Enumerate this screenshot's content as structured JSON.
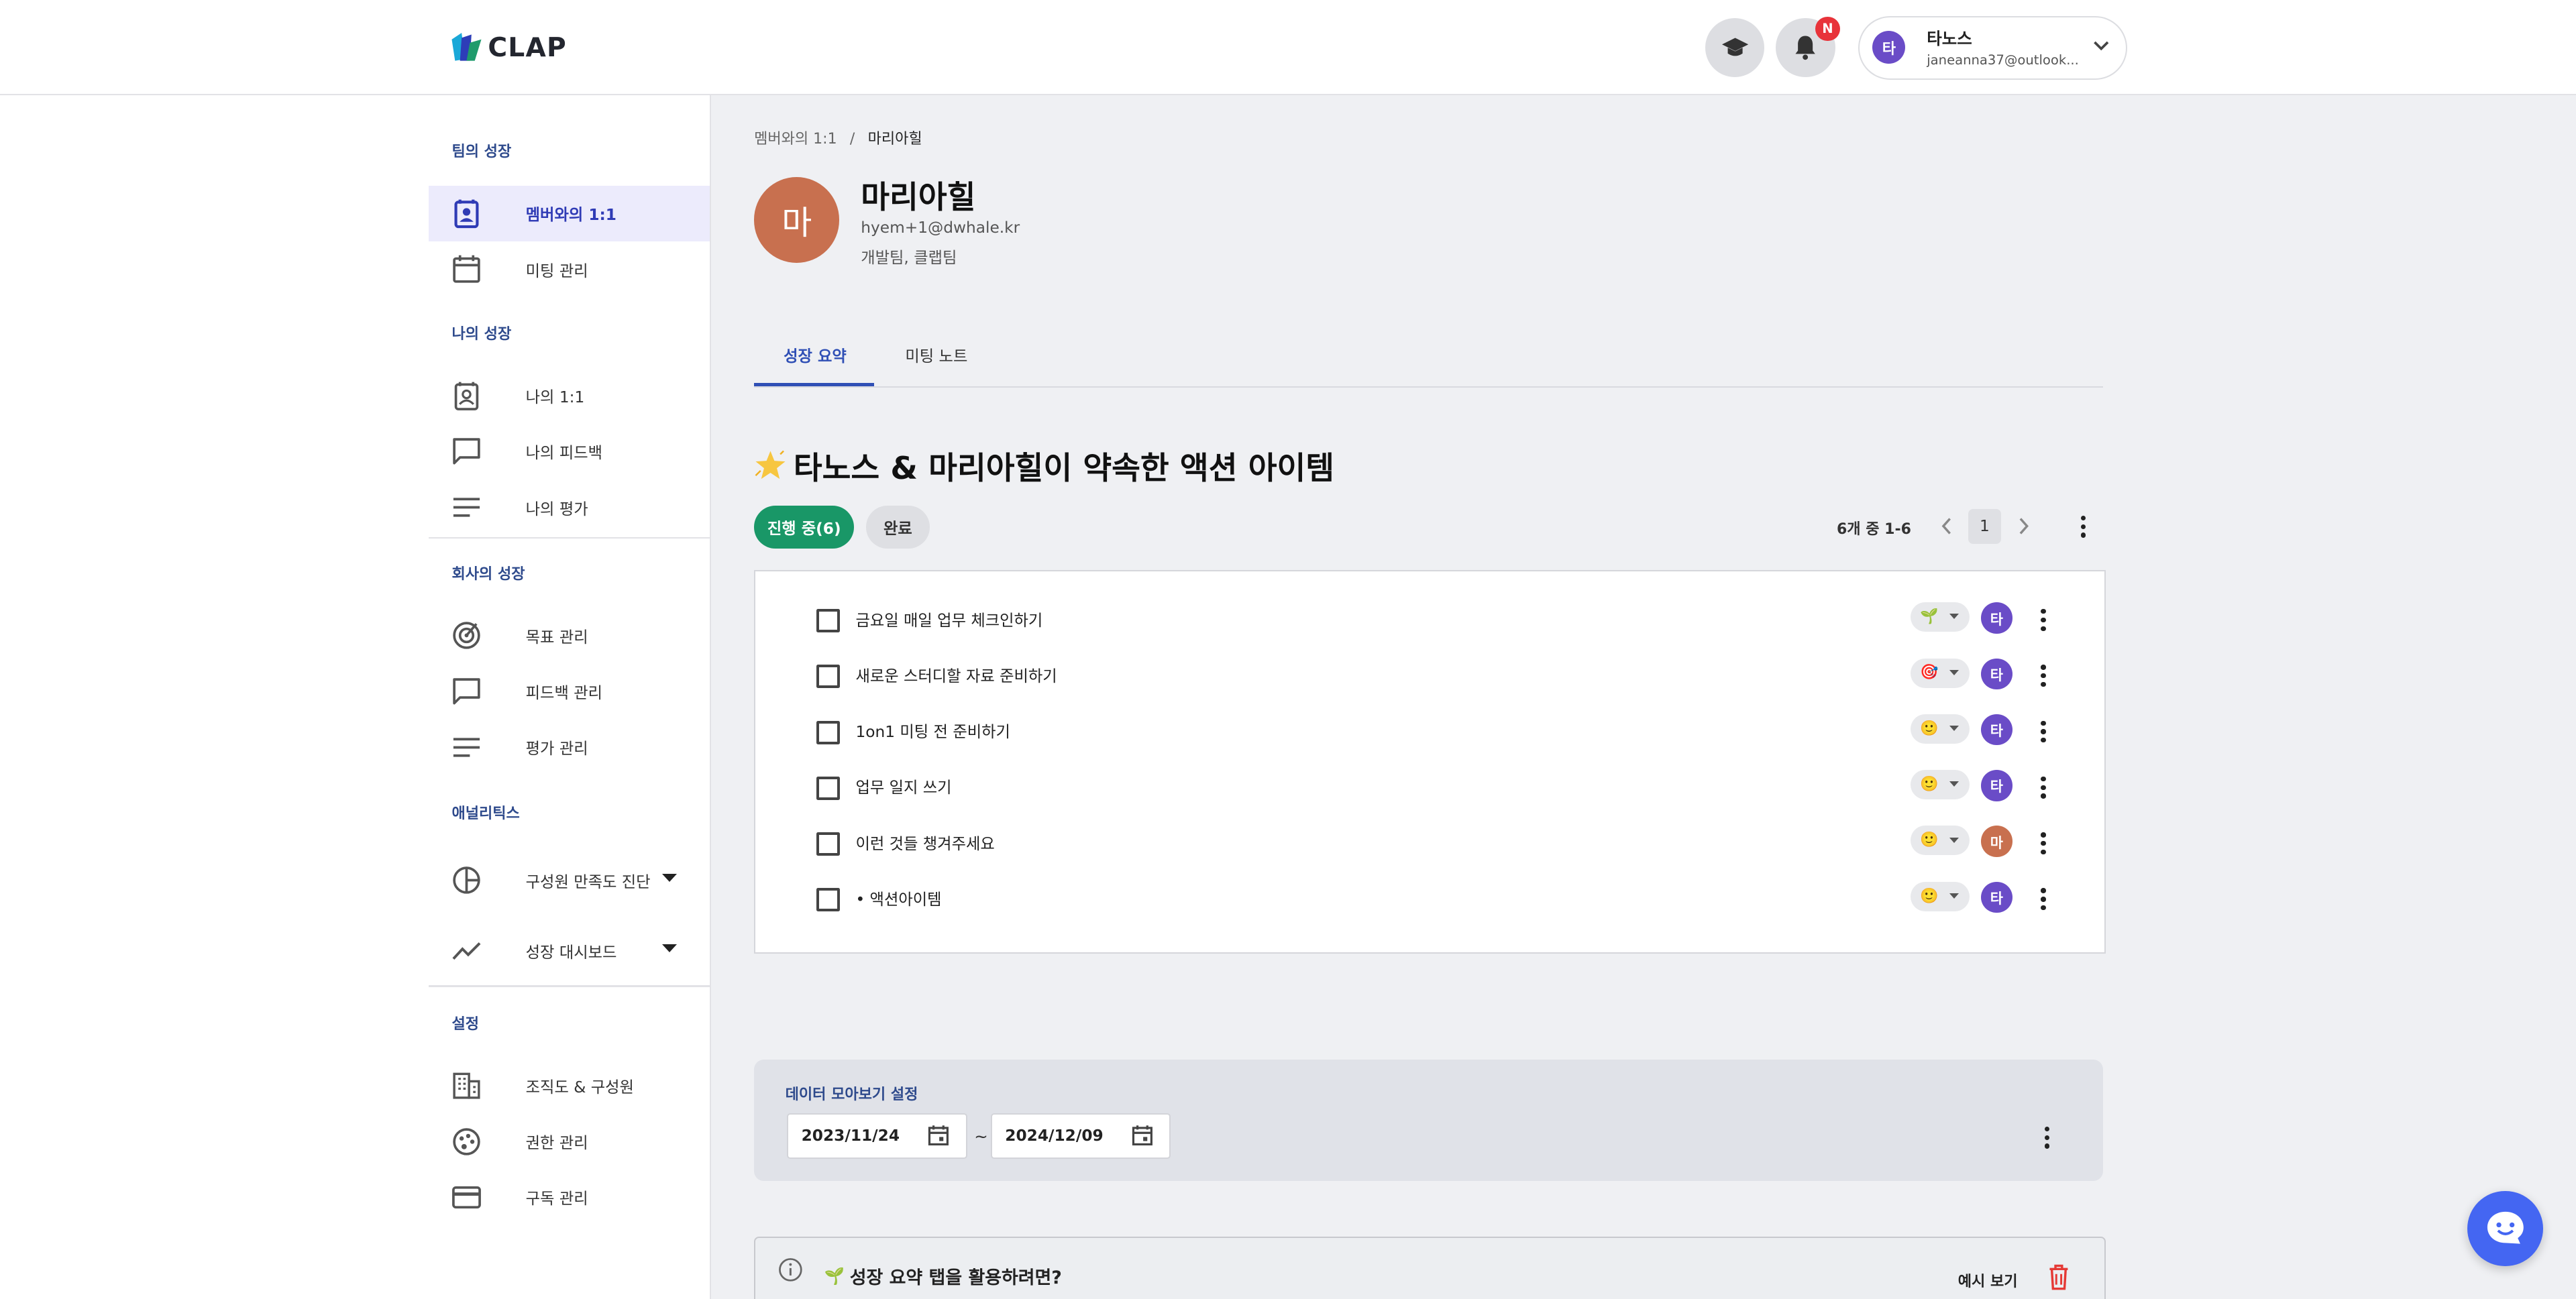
{
  "brand": {
    "name": "CLAP"
  },
  "header": {
    "notification_badge": "N",
    "user": {
      "initial": "타",
      "name": "타노스",
      "email": "janeanna37@outlook..."
    }
  },
  "sidebar": {
    "sections": [
      {
        "title": "팀의 성장",
        "items": [
          {
            "label": "멤버와의 1:1",
            "icon": "contact-card-icon",
            "active": true
          },
          {
            "label": "미팅 관리",
            "icon": "calendar-icon"
          }
        ]
      },
      {
        "title": "나의 성장",
        "items": [
          {
            "label": "나의 1:1",
            "icon": "contact-card-icon"
          },
          {
            "label": "나의 피드백",
            "icon": "chat-bubble-icon"
          },
          {
            "label": "나의 평가",
            "icon": "lines-icon"
          }
        ]
      },
      {
        "title": "회사의 성장",
        "items": [
          {
            "label": "목표 관리",
            "icon": "target-icon"
          },
          {
            "label": "피드백 관리",
            "icon": "chat-bubble-icon"
          },
          {
            "label": "평가 관리",
            "icon": "lines-icon"
          }
        ]
      },
      {
        "title": "애널리틱스",
        "items": [
          {
            "label": "구성원 만족도 진단",
            "icon": "pie-chart-icon",
            "expandable": true
          },
          {
            "label": "성장 대시보드",
            "icon": "trend-line-icon",
            "expandable": true
          }
        ]
      },
      {
        "title": "설정",
        "items": [
          {
            "label": "조직도 & 구성원",
            "icon": "building-icon"
          },
          {
            "label": "권한 관리",
            "icon": "palette-icon"
          },
          {
            "label": "구독 관리",
            "icon": "credit-card-icon"
          }
        ]
      }
    ]
  },
  "breadcrumb": {
    "parent": "멤버와의 1:1",
    "separator": "/",
    "current": "마리아힐"
  },
  "profile": {
    "initial": "마",
    "name": "마리아힐",
    "email": "hyem+1@dwhale.kr",
    "teams": "개발팀, 클랩팀"
  },
  "tabs": [
    {
      "label": "성장 요약",
      "active": true
    },
    {
      "label": "미팅 노트"
    }
  ],
  "action_items": {
    "title_emoji": "star-icon",
    "title": "타노스 & 마리아힐이 약속한 액션 아이템",
    "filter_in_progress": "진행 중(6)",
    "filter_done": "완료",
    "page_info": "6개 중 1-6",
    "current_page": "1",
    "items": [
      {
        "text": "금요일 매일 업무 체크인하기",
        "emoji": "🌱",
        "owner": "타",
        "owner_color": "#6a4cc7"
      },
      {
        "text": "새로운 스터디할 자료 준비하기",
        "emoji": "🎯",
        "owner": "타",
        "owner_color": "#6a4cc7"
      },
      {
        "text": "1on1 미팅 전 준비하기",
        "emoji": "🙂",
        "owner": "타",
        "owner_color": "#6a4cc7"
      },
      {
        "text": "업무 일지 쓰기",
        "emoji": "🙂",
        "owner": "타",
        "owner_color": "#6a4cc7"
      },
      {
        "text": "이런 것들 챙겨주세요",
        "emoji": "🙂",
        "owner": "마",
        "owner_color": "#c8704f"
      },
      {
        "text": "• 액션아이템",
        "emoji": "🙂",
        "owner": "타",
        "owner_color": "#6a4cc7"
      }
    ]
  },
  "data_settings": {
    "title": "데이터 모아보기 설정",
    "start_date": "2023/11/24",
    "end_date": "2024/12/09",
    "separator": "~"
  },
  "tip": {
    "emoji": "🌱",
    "title": "성장 요약 탭을 활용하려면?",
    "example_label": "예시 보기"
  },
  "colors": {
    "accent": "#2f4fb5",
    "active_bg": "#ecebfc",
    "green": "#199767",
    "badge_red": "#e8333a",
    "chat_blue": "#4466f2",
    "delete_red": "#e53935"
  }
}
